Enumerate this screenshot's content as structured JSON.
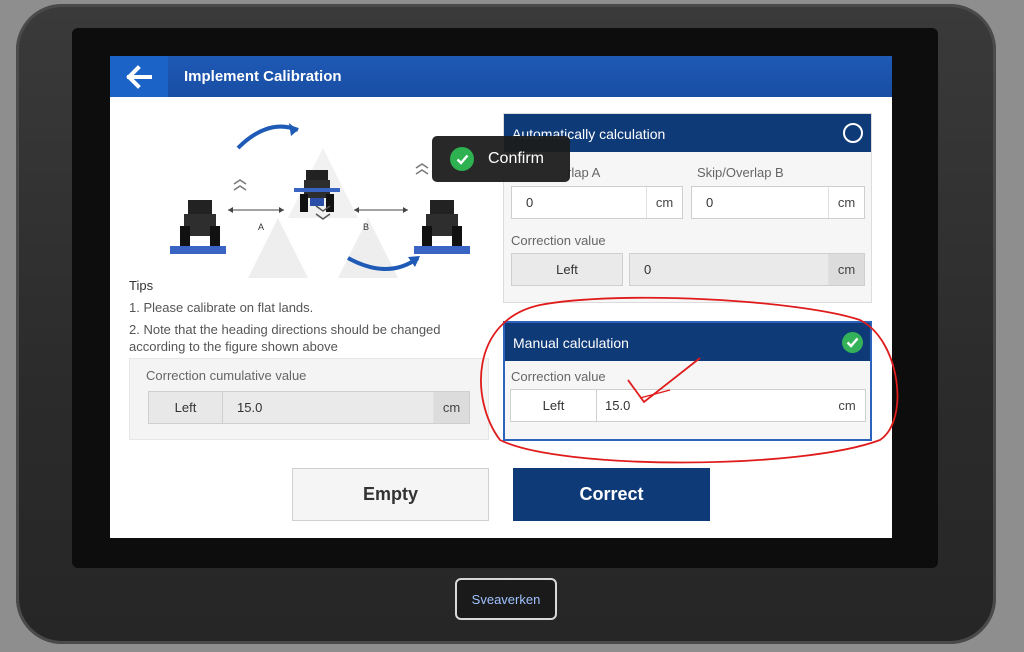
{
  "header": {
    "title": "Implement Calibration",
    "back_icon": "back-arrow-icon"
  },
  "figure": {
    "label_a": "A",
    "label_b": "B"
  },
  "tips": {
    "title": "Tips",
    "items": [
      "1. Please calibrate on flat lands.",
      "2. Note that the heading directions should be changed",
      "according to the figure shown above"
    ]
  },
  "cumulative": {
    "label": "Correction cumulative value",
    "direction": "Left",
    "value": "15.0",
    "unit": "cm"
  },
  "auto_panel": {
    "title": "Automatically calculation",
    "skip_a_label": "rlap A",
    "skip_a_value": "0",
    "skip_b_label": "Skip/Overlap B",
    "skip_b_value": "0",
    "unit": "cm",
    "correction_label": "Correction value",
    "correction_direction": "Left",
    "correction_value": "0"
  },
  "manual_panel": {
    "title": "Manual calculation",
    "correction_label": "Correction value",
    "correction_direction": "Left",
    "correction_value": "15.0",
    "unit": "cm"
  },
  "buttons": {
    "empty": "Empty",
    "correct": "Correct"
  },
  "toast": {
    "label": "Confirm"
  },
  "device": {
    "brand": "Sveaverken"
  },
  "colors": {
    "title_bar": "#1c56b0",
    "panel_head": "#0f3a78",
    "check": "#34b25a",
    "annotation": "#e01b1b"
  }
}
